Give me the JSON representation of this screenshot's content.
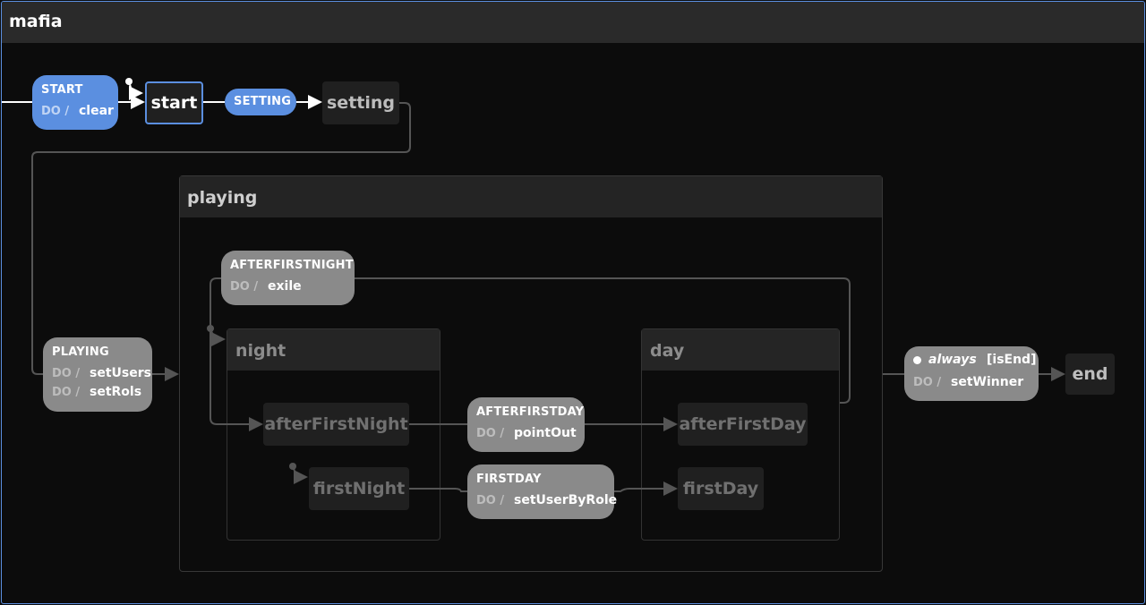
{
  "machine": {
    "title": "mafia"
  },
  "states": {
    "start": "start",
    "setting": "setting",
    "playing": "playing",
    "night": "night",
    "day": "day",
    "after_first_night": "afterFirstNight",
    "first_night": "firstNight",
    "after_first_day": "afterFirstDay",
    "first_day": "firstDay",
    "end": "end"
  },
  "events": {
    "start_event": {
      "name": "START",
      "do_label": "DO /",
      "actions": [
        "clear"
      ]
    },
    "setting_event": {
      "name": "SETTING"
    },
    "playing_event": {
      "name": "PLAYING",
      "do_label": "DO /",
      "actions": [
        "setUsers",
        "setRols"
      ]
    },
    "after_first_night_event": {
      "name": "AFTERFIRSTNIGHT",
      "do_label": "DO /",
      "actions": [
        "exile"
      ]
    },
    "after_first_day_event": {
      "name": "AFTERFIRSTDAY",
      "do_label": "DO /",
      "actions": [
        "pointOut"
      ]
    },
    "first_day_event": {
      "name": "FIRSTDAY",
      "do_label": "DO /",
      "actions": [
        "setUserByRole"
      ]
    },
    "always_event": {
      "name": "always",
      "guard": "[isEnd]",
      "do_label": "DO /",
      "actions": [
        "setWinner"
      ]
    }
  },
  "colors": {
    "accent": "#5b8fe0",
    "event_bg": "#8a8a8a",
    "edge": "#555555",
    "active_edge": "#ffffff",
    "state_bg": "#202020",
    "region_border": "#383838"
  }
}
